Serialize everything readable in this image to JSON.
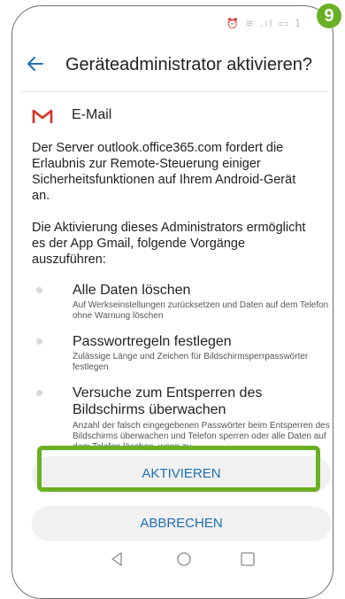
{
  "status_bar": {
    "icons": [
      "alarm-icon",
      "wifi-icon",
      "signal-icon",
      "battery-icon"
    ],
    "time_fragment": "1"
  },
  "step_badge": "9",
  "header": {
    "title": "Geräteadministrator aktivieren?"
  },
  "app": {
    "icon": "gmail-icon",
    "name": "E-Mail"
  },
  "paragraph_1": "Der Server outlook.office365.com fordert die Erlaubnis zur Remote-Steuerung einiger Sicherheitsfunktionen auf Ihrem Android-Gerät an.",
  "paragraph_2": "Die Aktivierung dieses Administrators ermöglicht es der App Gmail, folgende Vorgänge auszuführen:",
  "permissions": [
    {
      "title": "Alle Daten löschen",
      "description": "Auf Werkseinstellungen zurücksetzen und Daten auf dem Telefon ohne Warnung löschen"
    },
    {
      "title": "Passwortregeln festlegen",
      "description": "Zulässige Länge und Zeichen für Bildschirmsperrpasswörter festlegen"
    },
    {
      "title": "Versuche zum Entsperren des Bildschirms überwachen",
      "description": "Anzahl der falsch eingegebenen Passwörter beim Entsperren des Bildschirms überwachen und Telefon sperren oder alle Daten auf dem Telefon löschen, wenn zu"
    }
  ],
  "buttons": {
    "activate": "AKTIVIEREN",
    "cancel": "ABBRECHEN"
  },
  "colors": {
    "accent": "#1f6fb2",
    "highlight": "#6ab023",
    "button_bg": "#f1f1f1"
  }
}
